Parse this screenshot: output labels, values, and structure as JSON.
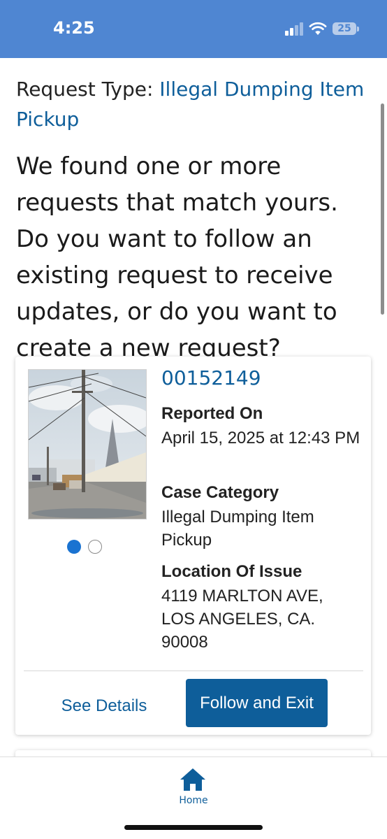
{
  "status_bar": {
    "time": "4:25",
    "battery": "25"
  },
  "request_type": {
    "label": "Request Type: ",
    "value": "Illegal Dumping Item Pickup"
  },
  "question": "We found one or more requests that match yours. Do you want to follow an existing request to receive updates, or do you want to create a new request?",
  "card": {
    "case_number": "00152149",
    "reported_on_label": "Reported On",
    "reported_on_value": "April 15, 2025 at 12:43 PM",
    "category_label": "Case Category",
    "category_value": "Illegal Dumping Item Pickup",
    "location_label": "Location Of Issue",
    "location_value": "4119 MARLTON AVE, LOS ANGELES, CA. 90008",
    "photo_count": 2,
    "photo_selected": 1,
    "see_details_label": "See Details",
    "follow_label": "Follow and Exit"
  },
  "tab_bar": {
    "home_label": "Home",
    "home_icon": "home-icon"
  },
  "colors": {
    "status_bar": "#4f86d2",
    "link_blue": "#0e5e9a",
    "button_blue": "#0e5e9a",
    "pager_active": "#1a73d1"
  }
}
